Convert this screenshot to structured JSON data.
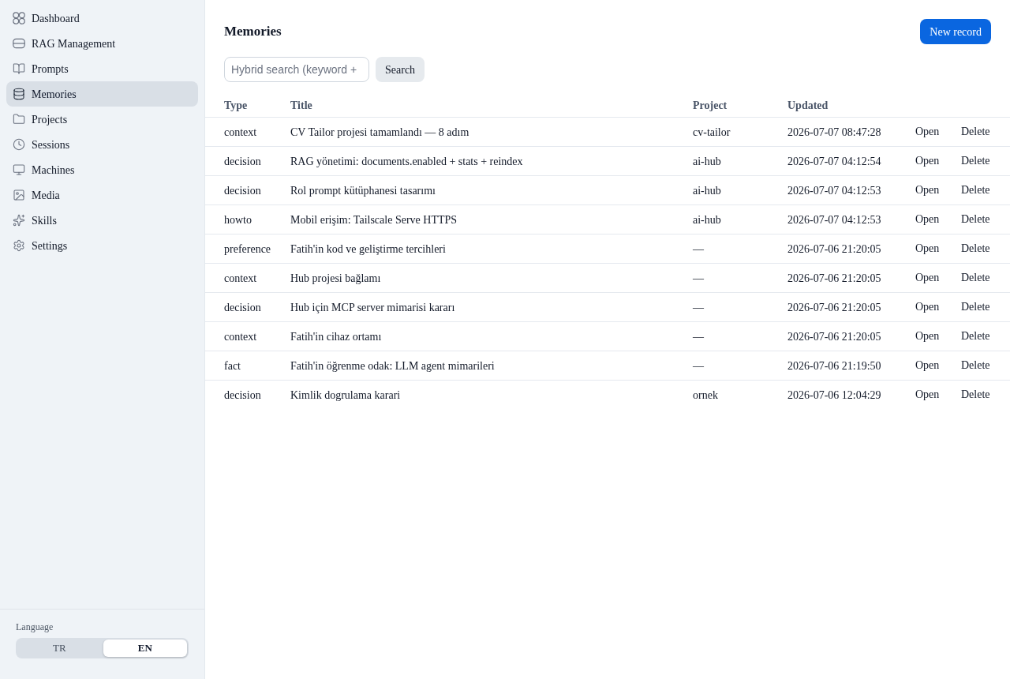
{
  "sidebar": {
    "items": [
      {
        "label": "Dashboard",
        "selected": false
      },
      {
        "label": "RAG Management",
        "selected": false
      },
      {
        "label": "Prompts",
        "selected": false
      },
      {
        "label": "Memories",
        "selected": true
      },
      {
        "label": "Projects",
        "selected": false
      },
      {
        "label": "Sessions",
        "selected": false
      },
      {
        "label": "Machines",
        "selected": false
      },
      {
        "label": "Media",
        "selected": false
      },
      {
        "label": "Skills",
        "selected": false
      },
      {
        "label": "Settings",
        "selected": false
      }
    ],
    "language": {
      "label": "Language",
      "options": [
        {
          "label": "TR",
          "selected": false
        },
        {
          "label": "EN",
          "selected": true
        }
      ]
    }
  },
  "header": {
    "title": "Memories",
    "new_button": "New record"
  },
  "search": {
    "placeholder": "Hybrid search (keyword +",
    "button": "Search"
  },
  "table": {
    "columns": [
      "Type",
      "Title",
      "Project",
      "Updated"
    ],
    "rows": [
      {
        "type": "context",
        "title": "CV Tailor projesi tamamlandı — 8 adım",
        "project": "cv-tailor",
        "updated": "2026-07-07 08:47:28",
        "actions": [
          "Open",
          "Delete"
        ]
      },
      {
        "type": "decision",
        "title": "RAG yönetimi: documents.enabled + stats + reindex",
        "project": "ai-hub",
        "updated": "2026-07-07 04:12:54",
        "actions": [
          "Open",
          "Delete"
        ]
      },
      {
        "type": "decision",
        "title": "Rol prompt kütüphanesi tasarımı",
        "project": "ai-hub",
        "updated": "2026-07-07 04:12:53",
        "actions": [
          "Open",
          "Delete"
        ]
      },
      {
        "type": "howto",
        "title": "Mobil erişim: Tailscale Serve HTTPS",
        "project": "ai-hub",
        "updated": "2026-07-07 04:12:53",
        "actions": [
          "Open",
          "Delete"
        ]
      },
      {
        "type": "preference",
        "title": "Fatih'in kod ve geliştirme tercihleri",
        "project": "—",
        "updated": "2026-07-06 21:20:05",
        "actions": [
          "Open",
          "Delete"
        ]
      },
      {
        "type": "context",
        "title": "Hub projesi bağlamı",
        "project": "—",
        "updated": "2026-07-06 21:20:05",
        "actions": [
          "Open",
          "Delete"
        ]
      },
      {
        "type": "decision",
        "title": "Hub için MCP server mimarisi kararı",
        "project": "—",
        "updated": "2026-07-06 21:20:05",
        "actions": [
          "Open",
          "Delete"
        ]
      },
      {
        "type": "context",
        "title": "Fatih'in cihaz ortamı",
        "project": "—",
        "updated": "2026-07-06 21:20:05",
        "actions": [
          "Open",
          "Delete"
        ]
      },
      {
        "type": "fact",
        "title": "Fatih'in öğrenme odak: LLM agent mimarileri",
        "project": "—",
        "updated": "2026-07-06 21:19:50",
        "actions": [
          "Open",
          "Delete"
        ]
      },
      {
        "type": "decision",
        "title": "Kimlik dogrulama karari",
        "project": "ornek",
        "updated": "2026-07-06 12:04:29",
        "actions": [
          "Open",
          "Delete"
        ]
      }
    ]
  }
}
